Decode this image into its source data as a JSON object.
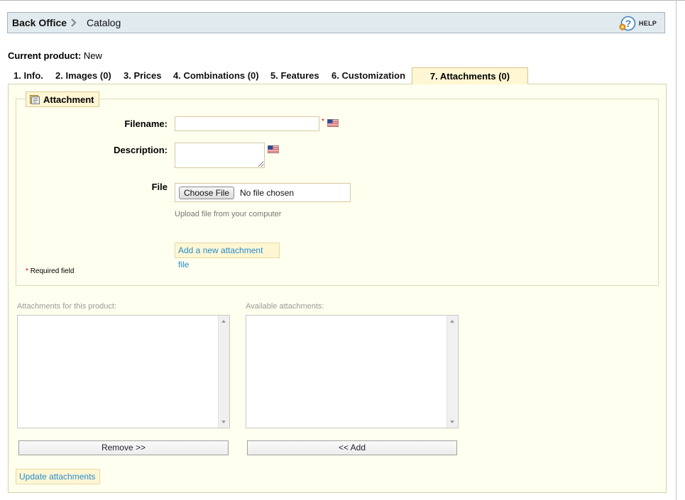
{
  "breadcrumb": {
    "home": "Back Office",
    "current": "Catalog"
  },
  "help": {
    "label": "HELP"
  },
  "current_product": {
    "label": "Current product:",
    "value": "New"
  },
  "tabs": [
    {
      "label": "1. Info."
    },
    {
      "label": "2. Images (0)"
    },
    {
      "label": "3. Prices"
    },
    {
      "label": "4. Combinations (0)"
    },
    {
      "label": "5. Features"
    },
    {
      "label": "6. Customization"
    },
    {
      "label": "7. Attachments (0)",
      "active": true
    }
  ],
  "attachment_form": {
    "legend": "Attachment",
    "filename_label": "Filename:",
    "filename_value": "",
    "description_label": "Description:",
    "description_value": "",
    "file_label": "File",
    "choose_file": "Choose File",
    "no_file": "No file chosen",
    "upload_hint": "Upload file from your computer",
    "add_button": "Add a new attachment file",
    "required_star": "*",
    "required_note": "Required field"
  },
  "lists": {
    "product_label": "Attachments for this product:",
    "available_label": "Available attachments:",
    "product_items": [],
    "available_items": [],
    "remove_button": "Remove >>",
    "add_button": "<< Add"
  },
  "update_button": "Update attachments",
  "colors": {
    "panel_bg": "#ffffef",
    "tab_active_bg": "#fff6d3",
    "link_blue": "#268ccd",
    "required_red": "#cc0000",
    "crumb_bg": "#e1eaee"
  },
  "icons": {
    "crumb_separator": "chevron-right-icon",
    "help": "help-question-icon",
    "legend": "attachment-icon",
    "language": "us-flag-icon"
  }
}
